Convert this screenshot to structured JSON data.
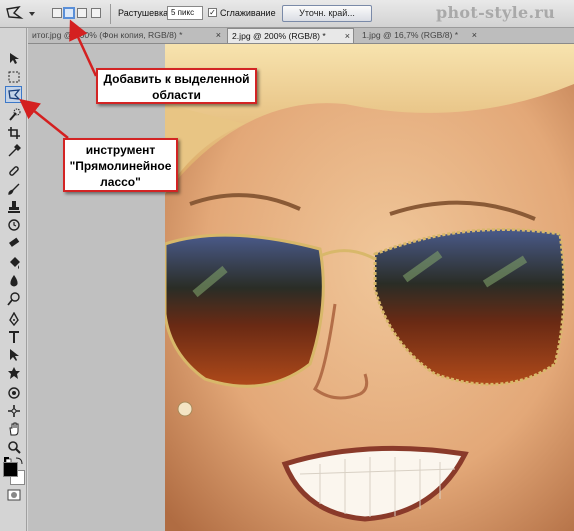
{
  "options_bar": {
    "feather_label": "Растушевка:",
    "feather_value": "5 пикс",
    "antialias_label": "Сглаживание",
    "antialias_checked": "✓",
    "refine_button": "Уточн. край..."
  },
  "watermark": "phot-style.ru",
  "tabs": [
    {
      "label": "итог.jpg @ 100% (Фон копия, RGB/8) *",
      "close": "×"
    },
    {
      "label": "2.jpg @ 200% (RGB/8) *",
      "close": "×"
    },
    {
      "label": "1.jpg @ 16,7% (RGB/8) *",
      "close": "×"
    }
  ],
  "callouts": {
    "add_to_selection": {
      "line1": "Добавить к выделенной",
      "line2": "области"
    },
    "polygonal_lasso": {
      "line1": "инструмент",
      "line2": "\"Прямолинейное",
      "line3": "лассо\""
    }
  },
  "colors": {
    "callout_border": "#d32424",
    "arrow": "#d42020",
    "active_tool": "#3c78c8"
  },
  "icons": [
    "polygonal-lasso-icon",
    "move-icon",
    "marquee-icon",
    "lasso-icon",
    "quick-selection-icon",
    "crop-icon",
    "eyedropper-icon",
    "healing-brush-icon",
    "brush-icon",
    "clone-stamp-icon",
    "history-brush-icon",
    "eraser-icon",
    "gradient-icon",
    "blur-icon",
    "dodge-icon",
    "pen-icon",
    "type-icon",
    "path-selection-icon",
    "shape-icon",
    "3d-rotate-icon",
    "3d-orbit-icon",
    "hand-icon",
    "zoom-icon",
    "quick-mask-icon"
  ]
}
